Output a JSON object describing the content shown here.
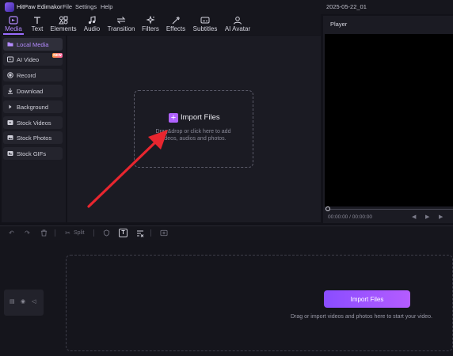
{
  "titlebar": {
    "app_name": "HitPaw Edimakor",
    "menu": [
      "File",
      "Settings",
      "Help"
    ],
    "project_name": "2025-05-22_01"
  },
  "toolbar": {
    "tools": [
      {
        "label": "Media",
        "icon": "media-icon",
        "active": true
      },
      {
        "label": "Text",
        "icon": "text-icon"
      },
      {
        "label": "Elements",
        "icon": "elements-icon"
      },
      {
        "label": "Audio",
        "icon": "audio-icon"
      },
      {
        "label": "Transition",
        "icon": "transition-icon"
      },
      {
        "label": "Filters",
        "icon": "filters-icon"
      },
      {
        "label": "Effects",
        "icon": "effects-icon"
      },
      {
        "label": "Subtitles",
        "icon": "subtitles-icon"
      },
      {
        "label": "AI Avatar",
        "icon": "ai-avatar-icon"
      }
    ]
  },
  "sidebar": {
    "items": [
      {
        "label": "Local Media",
        "icon": "folder-icon",
        "active": true
      },
      {
        "label": "AI Video",
        "icon": "ai-video-icon",
        "badge": "NEW"
      },
      {
        "label": "Record",
        "icon": "record-icon"
      },
      {
        "label": "Download",
        "icon": "download-icon"
      },
      {
        "label": "Background",
        "icon": "background-icon"
      },
      {
        "label": "Stock Videos",
        "icon": "stock-videos-icon"
      },
      {
        "label": "Stock Photos",
        "icon": "stock-photos-icon"
      },
      {
        "label": "Stock GIFs",
        "icon": "stock-gifs-icon"
      }
    ]
  },
  "media": {
    "import_label": "Import Files",
    "import_hint": "Drag&drop or click here to add videos, audios and photos."
  },
  "player": {
    "title": "Player",
    "timecode": "00:00:00 / 00:00:00"
  },
  "timeline_toolbar": {
    "split_label": "Split"
  },
  "timeline": {
    "import_button": "Import Files",
    "hint": "Drag or import videos and photos here to start your video."
  },
  "colors": {
    "accent": "#9b6cff",
    "annotation_arrow": "#e8262f"
  }
}
